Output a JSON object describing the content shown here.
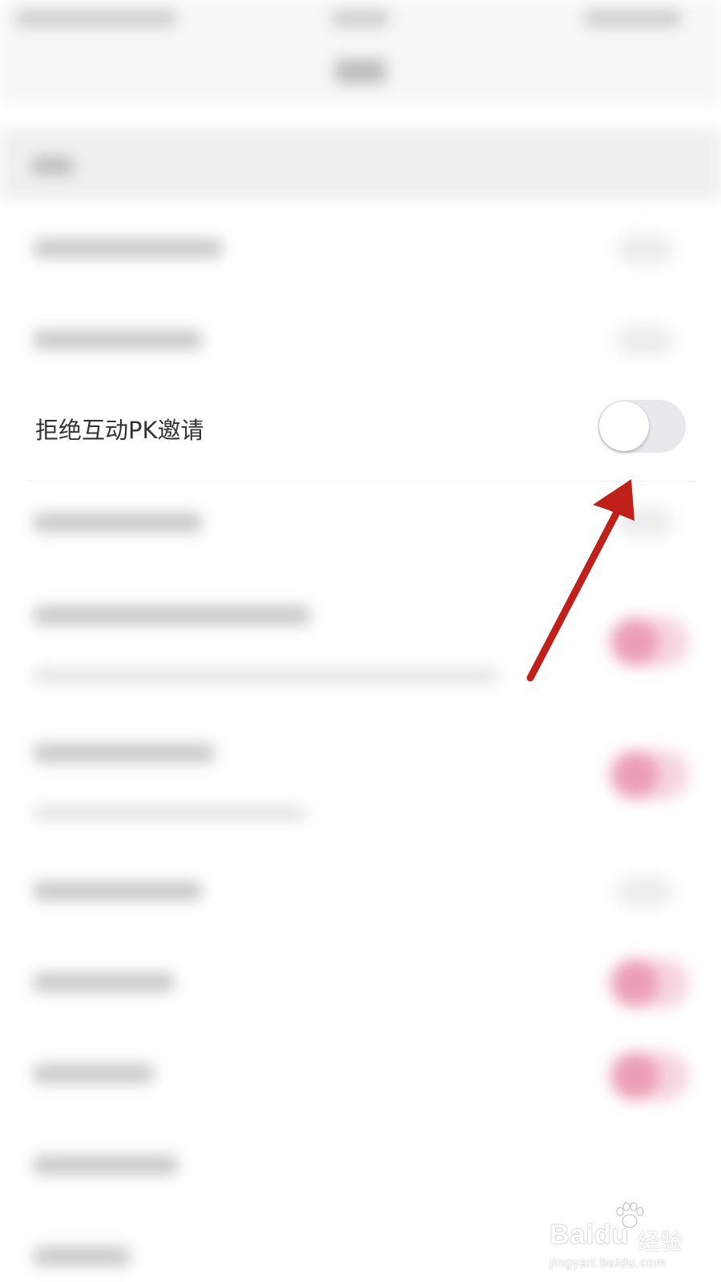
{
  "settings": {
    "focused_item": {
      "label": "拒绝互动PK邀请",
      "toggle_state": "off"
    }
  },
  "annotation": {
    "arrow_color": "#c0201a"
  },
  "watermark": {
    "brand": "Baidu",
    "suffix": "经验",
    "url": "jingyan.baidu.com"
  },
  "colors": {
    "toggle_off_track": "#e9e9ec",
    "toggle_on_blurred": "#ec9fb4"
  }
}
